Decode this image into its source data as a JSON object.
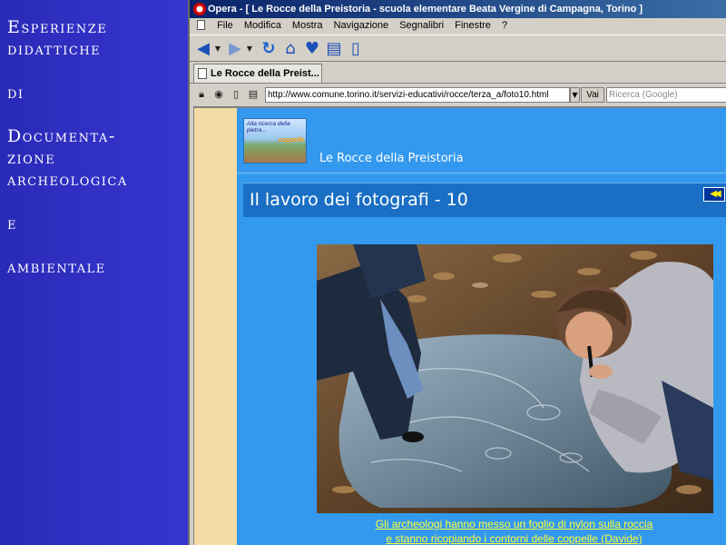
{
  "left_panel": {
    "lines": [
      "Esperienze",
      "didattiche",
      "",
      "di",
      "",
      "Documenta-",
      "zione",
      "archeologica",
      "",
      "e",
      "",
      "ambientale"
    ]
  },
  "browser": {
    "title": "Opera - [ Le Rocce della Preistoria - scuola elementare Beata Vergine di Campagna, Torino ]",
    "menu": [
      "File",
      "Modifica",
      "Mostra",
      "Navigazione",
      "Segnalibri",
      "Finestre",
      "?"
    ],
    "toolbar_icons": [
      "back-icon",
      "dropdown-icon",
      "forward-icon",
      "dropdown-icon",
      "reload-icon",
      "home-icon",
      "hotlist-icon",
      "print-icon",
      "new-page-icon"
    ],
    "tab_label": "Le Rocce della Preist...",
    "address_icons": [
      "lock-icon",
      "cookie-icon",
      "page-info-icon",
      "print-icon"
    ],
    "url": "http://www.comune.torino.it/servizi-educativi/rocce/terza_a/foto10.html",
    "go_label": "Vai",
    "search_placeholder": "Ricerca (Google)"
  },
  "page": {
    "site_title": "Le Rocce della Preistoria",
    "banner_text_1": "Alla ricerca della pietra...",
    "banner_text_2": "coppelle",
    "heading": "Il lavoro dei fotografi - 10",
    "back_arrow_icon": "rewind-icon",
    "caption_line_1": "Gli archeologi hanno messo un foglio di nylon sulla roccia",
    "caption_line_2": "e stanno ricopiando i contorni delle coppelle (Davide)"
  },
  "colors": {
    "left_panel_bg": "#3232c8",
    "page_bg": "#3399ee",
    "heading_bar": "#1a6fc4",
    "margin_bg": "#f5dca4",
    "caption": "#ffff33"
  }
}
